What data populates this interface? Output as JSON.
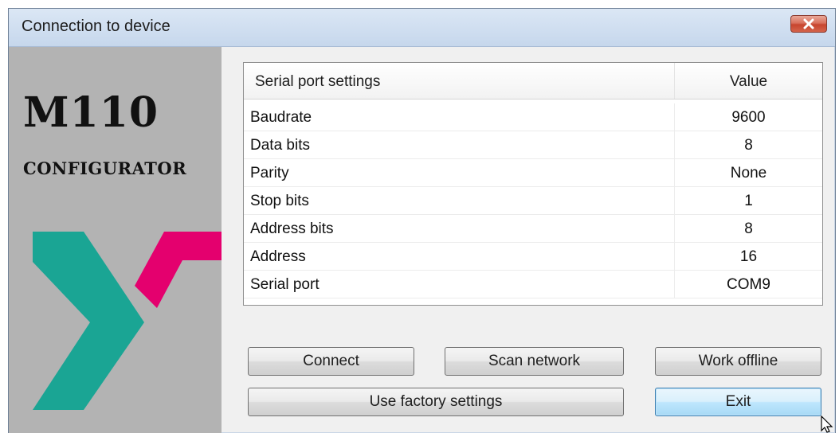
{
  "window": {
    "title": "Connection to device"
  },
  "branding": {
    "title": "M110",
    "subtitle": "CONFIGURATOR",
    "colors": {
      "teal": "#1aa594",
      "magenta": "#e4006e",
      "panel": "#b3b3b3"
    }
  },
  "settings_table": {
    "headers": {
      "name": "Serial port settings",
      "value": "Value"
    },
    "rows": [
      {
        "name": "Baudrate",
        "value": "9600"
      },
      {
        "name": "Data bits",
        "value": "8"
      },
      {
        "name": "Parity",
        "value": "None"
      },
      {
        "name": "Stop bits",
        "value": "1"
      },
      {
        "name": "Address bits",
        "value": "8"
      },
      {
        "name": "Address",
        "value": "16"
      },
      {
        "name": "Serial port",
        "value": "COM9"
      }
    ]
  },
  "buttons": {
    "connect": "Connect",
    "scan_network": "Scan network",
    "work_offline": "Work offline",
    "factory_settings": "Use factory settings",
    "exit": "Exit"
  },
  "icons": {
    "close": "close-icon",
    "cursor": "mouse-cursor-icon"
  }
}
